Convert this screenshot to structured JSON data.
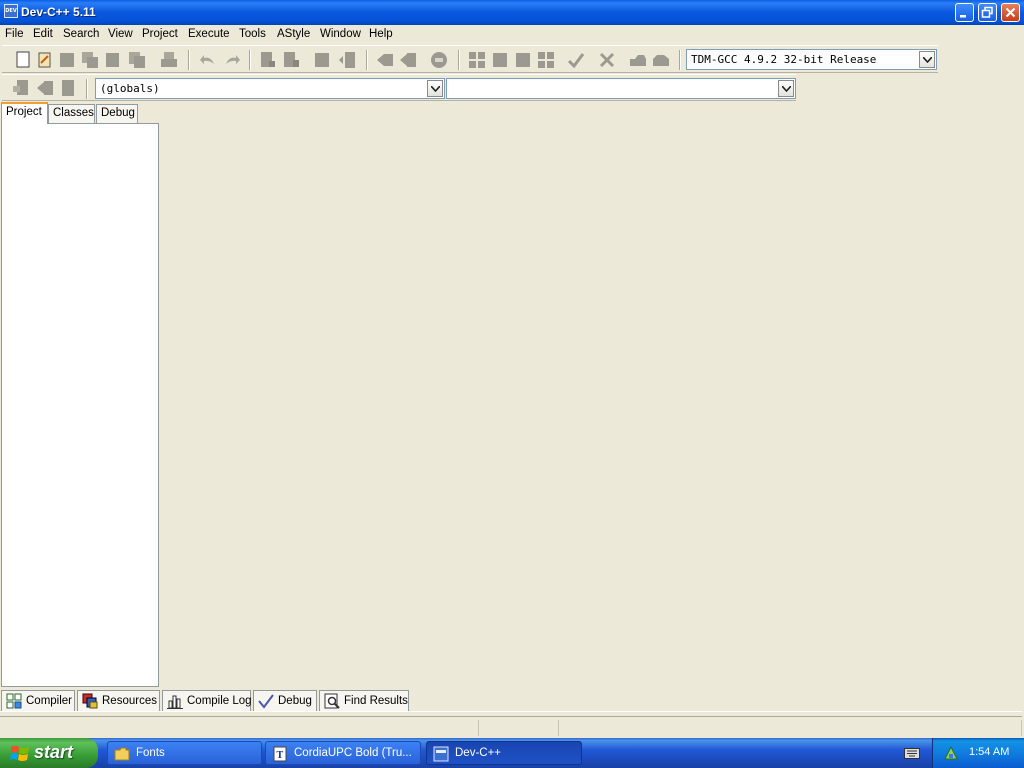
{
  "window": {
    "title": "Dev-C++ 5.11",
    "icon_text": "DEV"
  },
  "menu": [
    "File",
    "Edit",
    "Search",
    "View",
    "Project",
    "Execute",
    "Tools",
    "AStyle",
    "Window",
    "Help"
  ],
  "toolbar": {
    "compiler_select": "TDM-GCC 4.9.2 32-bit Release",
    "scope_select": "(globals)",
    "member_select": ""
  },
  "left_panel": {
    "tabs": [
      "Project",
      "Classes",
      "Debug"
    ],
    "active_tab": "Project"
  },
  "bottom_tabs": [
    {
      "label": "Compiler",
      "icon": "compiler-grid-icon"
    },
    {
      "label": "Resources",
      "icon": "resources-icon"
    },
    {
      "label": "Compile Log",
      "icon": "bar-chart-icon"
    },
    {
      "label": "Debug",
      "icon": "check-icon"
    },
    {
      "label": "Find Results",
      "icon": "find-icon"
    }
  ],
  "taskbar": {
    "start_label": "start",
    "tasks": [
      {
        "label": "Fonts",
        "icon": "folder-icon"
      },
      {
        "label": "CordiaUPC Bold (Tru...",
        "icon": "font-file-icon"
      },
      {
        "label": "Dev-C++",
        "icon": "devcpp-icon"
      }
    ],
    "clock": "1:54 AM"
  },
  "colors": {
    "titlebar": "#0A58DF",
    "chrome": "#ECE9D8",
    "taskbar": "#2157D7",
    "start_button": "#379C35",
    "tray": "#0F7DE0"
  }
}
